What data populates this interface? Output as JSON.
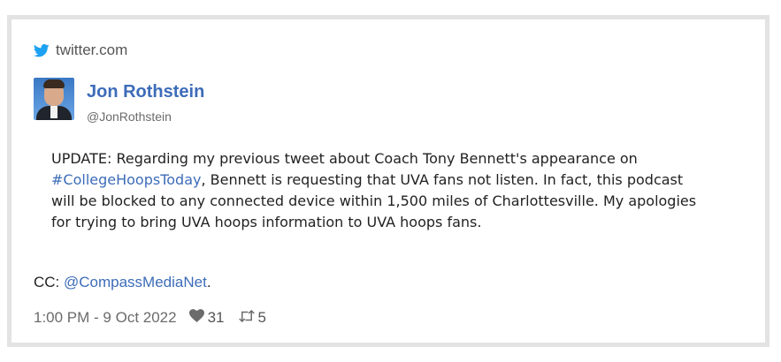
{
  "source": {
    "domain": "twitter.com",
    "icon": "twitter-bird-icon"
  },
  "author": {
    "display_name": "Jon Rothstein",
    "handle": "@JonRothstein",
    "avatar": "profile-photo"
  },
  "tweet": {
    "text_before": "UPDATE: Regarding my previous tweet about Coach Tony Bennett's appearance on ",
    "hashtag": "#CollegeHoopsToday",
    "text_after": ", Bennett is requesting that UVA fans not listen. In fact, this podcast will be blocked to any connected device within 1,500 miles of Charlottesville. My apologies for trying to bring UVA hoops information to UVA hoops fans."
  },
  "cc": {
    "prefix": "CC: ",
    "mention": "@CompassMediaNet",
    "suffix": "."
  },
  "meta": {
    "timestamp": "1:00 PM - 9 Oct 2022",
    "likes": "31",
    "retweets": "5"
  },
  "colors": {
    "link": "#3d6cb9",
    "twitter_blue": "#1da1f2",
    "frame_border": "#e3e3e3"
  }
}
